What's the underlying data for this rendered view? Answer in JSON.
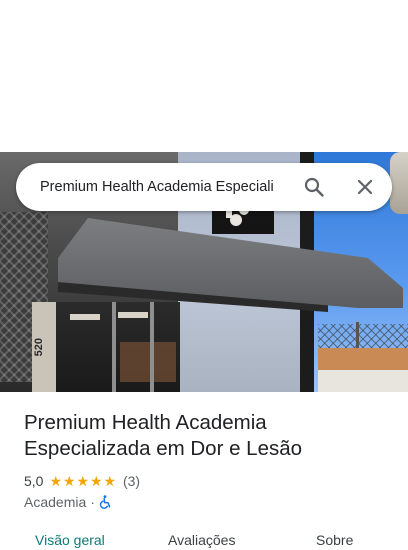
{
  "search": {
    "query": "Premium Health Academia Especiali",
    "search_icon": "search-icon",
    "close_icon": "close-icon"
  },
  "photo": {
    "building_number": "520"
  },
  "place": {
    "name": "Premium Health Academia Especializada em Dor e Lesão",
    "rating": "5,0",
    "stars": 5,
    "review_count": "(3)",
    "category": "Academia",
    "separator": "·",
    "accessibility_icon": "wheelchair-accessible-icon"
  },
  "tabs": [
    {
      "label": "Visão geral",
      "active": true
    },
    {
      "label": "Avaliações",
      "active": false
    },
    {
      "label": "Sobre",
      "active": false
    }
  ],
  "colors": {
    "accent_tab": "#0b7a75",
    "star": "#f2a600",
    "accessibility": "#1a73e8"
  }
}
